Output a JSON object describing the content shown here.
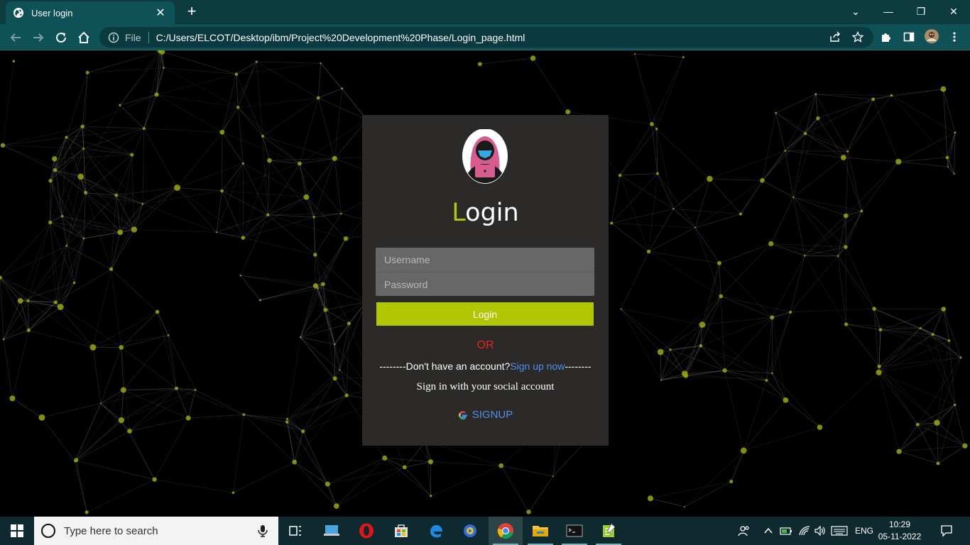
{
  "browser": {
    "tab_title": "User login",
    "tab_close": "✕",
    "new_tab": "+",
    "scheme": "File",
    "url": "C:/Users/ELCOT/Desktop/ibm/Project%20Development%20Phase/Login_page.html",
    "window_controls": {
      "dropdown": "⌄",
      "minimize": "—",
      "restore": "❐",
      "close": "✕"
    }
  },
  "login": {
    "title_first": "L",
    "title_rest": "ogin",
    "username_placeholder": "Username",
    "password_placeholder": "Password",
    "login_button": "Login",
    "or_text": "OR",
    "no_account_prefix": "--------Don't have an account?",
    "signup_link": "Sign up now",
    "no_account_suffix": "--------",
    "social_text": "Sign in with your social account",
    "google_signup": "SIGNUP"
  },
  "taskbar": {
    "search_placeholder": "Type here to search",
    "language": "ENG",
    "time": "10:29",
    "date": "05-11-2022"
  },
  "colors": {
    "accent": "#b2c704",
    "card_bg": "#2b2a28",
    "link": "#4c8ee9",
    "or": "#e02424",
    "browser_frame": "#0e5157"
  }
}
